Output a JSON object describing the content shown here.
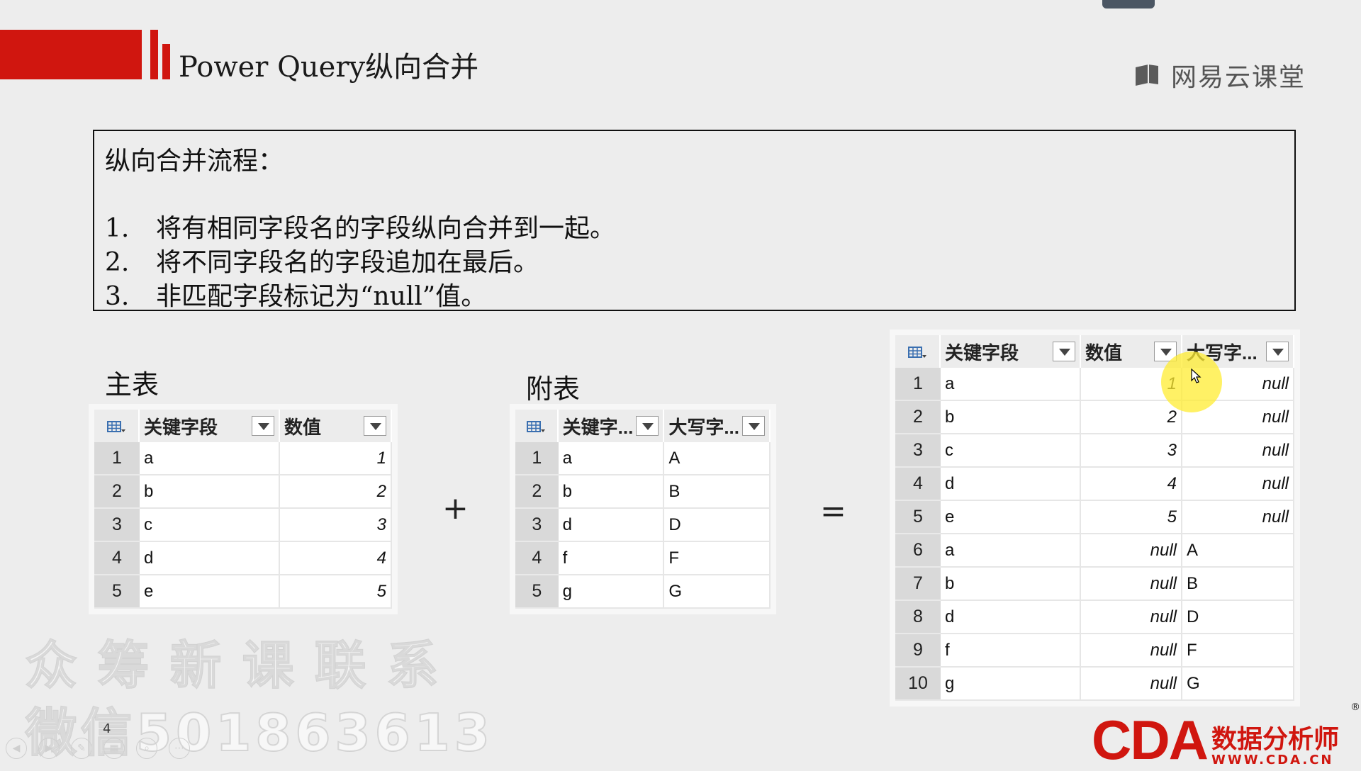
{
  "slide": {
    "title": "Power Query纵向合并",
    "brand": "网易云课堂",
    "page_number": "4"
  },
  "process": {
    "heading": "纵向合并流程：",
    "steps": [
      {
        "num": "1.",
        "text": "将有相同字段名的字段纵向合并到一起。"
      },
      {
        "num": "2.",
        "text": "将不同字段名的字段追加在最后。"
      },
      {
        "num": "3.",
        "text": "非匹配字段标记为“null”值。"
      }
    ]
  },
  "main_table": {
    "label": "主表",
    "headers": [
      "关键字段",
      "数值"
    ],
    "rows": [
      {
        "n": "1",
        "key": "a",
        "val": "1"
      },
      {
        "n": "2",
        "key": "b",
        "val": "2"
      },
      {
        "n": "3",
        "key": "c",
        "val": "3"
      },
      {
        "n": "4",
        "key": "d",
        "val": "4"
      },
      {
        "n": "5",
        "key": "e",
        "val": "5"
      }
    ]
  },
  "sub_table": {
    "label": "附表",
    "headers": [
      "关键字...",
      "大写字..."
    ],
    "rows": [
      {
        "n": "1",
        "key": "a",
        "cap": "A"
      },
      {
        "n": "2",
        "key": "b",
        "cap": "B"
      },
      {
        "n": "3",
        "key": "d",
        "cap": "D"
      },
      {
        "n": "4",
        "key": "f",
        "cap": "F"
      },
      {
        "n": "5",
        "key": "g",
        "cap": "G"
      }
    ]
  },
  "operators": {
    "plus": "+",
    "equals": "="
  },
  "result_table": {
    "headers": [
      "关键字段",
      "数值",
      "大写字..."
    ],
    "rows": [
      {
        "n": "1",
        "key": "a",
        "val": "1",
        "cap": "null"
      },
      {
        "n": "2",
        "key": "b",
        "val": "2",
        "cap": "null"
      },
      {
        "n": "3",
        "key": "c",
        "val": "3",
        "cap": "null"
      },
      {
        "n": "4",
        "key": "d",
        "val": "4",
        "cap": "null"
      },
      {
        "n": "5",
        "key": "e",
        "val": "5",
        "cap": "null"
      },
      {
        "n": "6",
        "key": "a",
        "val": "null",
        "cap": "A"
      },
      {
        "n": "7",
        "key": "b",
        "val": "null",
        "cap": "B"
      },
      {
        "n": "8",
        "key": "d",
        "val": "null",
        "cap": "D"
      },
      {
        "n": "9",
        "key": "f",
        "val": "null",
        "cap": "F"
      },
      {
        "n": "10",
        "key": "g",
        "val": "null",
        "cap": "G"
      }
    ]
  },
  "watermark": {
    "line1": "众筹新课联系",
    "line2": "微信5018636​13"
  },
  "footer": {
    "cda_logo": "CDA",
    "cda_cn": "数据分析师",
    "cda_url": "WWW.CDA.CN",
    "registered": "®"
  },
  "colors": {
    "accent_red": "#d0160f",
    "highlight_yellow": "#ffec32"
  }
}
